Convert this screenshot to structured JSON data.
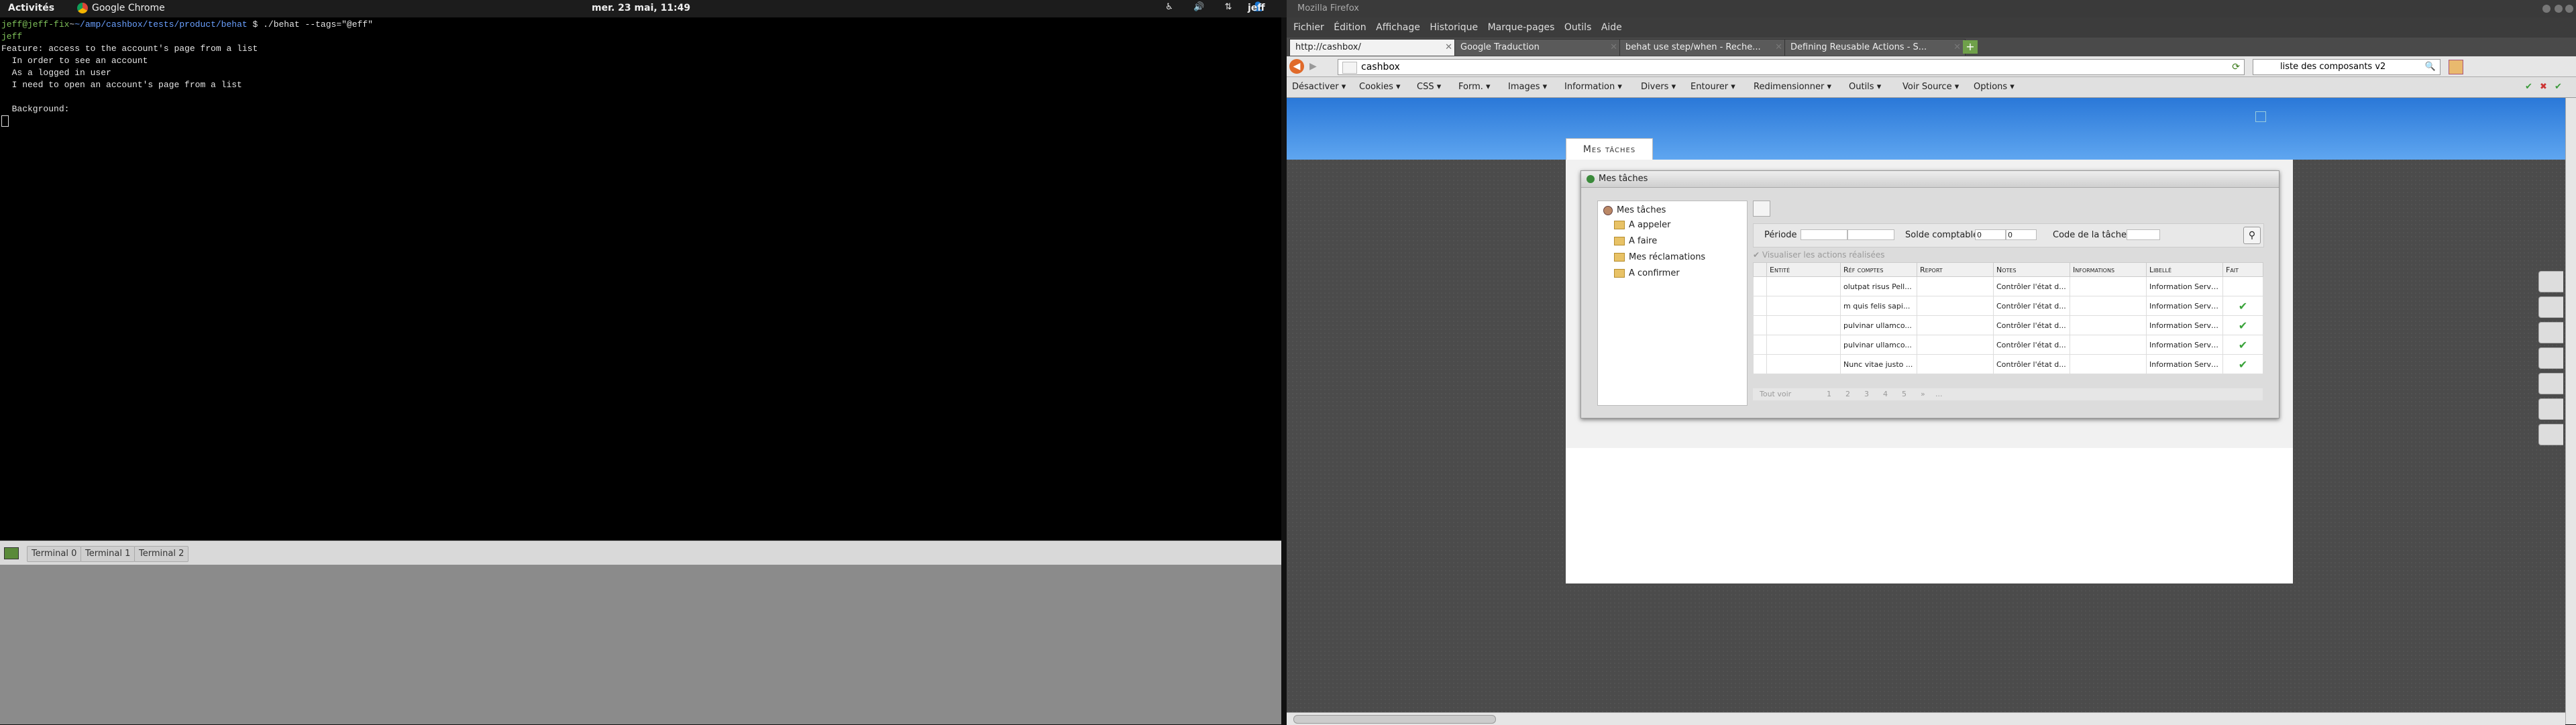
{
  "topbar": {
    "activities": "Activités",
    "app_name": "Google Chrome",
    "clock": "mer. 23 mai, 11:49",
    "user": "jeff"
  },
  "terminal": {
    "prompt_user": "jeff@jeff-fix",
    "prompt_path": "~/amp/cashbox/tests/product/behat",
    "command": "$ ./behat --tags=\"@eff\"",
    "prompt_line2": "jeff",
    "lines": [
      "Feature: access to the account's page from a list",
      "  In order to see an account",
      "  As a logged in user",
      "  I need to open an account's page from a list",
      "",
      "  Background:"
    ],
    "tabs": [
      "Terminal 0",
      "Terminal 1",
      "Terminal 2"
    ]
  },
  "firefox": {
    "window_title": "Mozilla Firefox",
    "menu": [
      "Fichier",
      "Édition",
      "Affichage",
      "Historique",
      "Marque-pages",
      "Outils",
      "Aide"
    ],
    "tabs": [
      {
        "label": "http://cashbox/",
        "active": true
      },
      {
        "label": "Google Traduction",
        "active": false
      },
      {
        "label": "behat use step/when - Reche...",
        "active": false
      },
      {
        "label": "Defining Reusable Actions - S...",
        "active": false
      }
    ],
    "url": "cashbox",
    "search_value": "liste des composants v2",
    "devbar": [
      "Désactiver ▾",
      "Cookies ▾",
      "CSS ▾",
      "Form. ▾",
      "Images ▾",
      "Information ▾",
      "Divers ▾",
      "Entourer ▾",
      "Redimensionner ▾",
      "Outils ▾",
      "Voir Source ▾",
      "Options ▾"
    ]
  },
  "app": {
    "title_tab": "Mes tâches",
    "dialog_title": "Mes tâches",
    "tree": {
      "root": "Mes tâches",
      "children": [
        "A appeler",
        "A faire",
        "Mes réclamations",
        "A confirmer"
      ]
    },
    "filters": {
      "periode_label": "Période",
      "solde_label": "Solde comptable",
      "solde_min": "0",
      "solde_max": "0",
      "code_label": "Code de la tâche"
    },
    "show_done_label": "Visualiser les actions réalisées",
    "columns": [
      "",
      "Entité",
      "Réf comptes",
      "Report",
      "Notes",
      "Informations",
      "Libellé",
      "Fait"
    ],
    "rows": [
      [
        "",
        "",
        "olutpat risus Pell...",
        "",
        "Contrôler l'état d...",
        "",
        "Information Servi...",
        ""
      ],
      [
        "",
        "",
        "m quis felis sapi...",
        "",
        "Contrôler l'état d...",
        "",
        "Information Servi...",
        "✔"
      ],
      [
        "",
        "",
        "pulvinar ullamco...",
        "",
        "Contrôler l'état d...",
        "",
        "Information Servi...",
        "✔"
      ],
      [
        "",
        "",
        "pulvinar ullamco...",
        "",
        "Contrôler l'état d...",
        "",
        "Information Servi...",
        "✔"
      ],
      [
        "",
        "",
        "Nunc vitae justo ...",
        "",
        "Contrôler l'état d...",
        "",
        "Information Servi...",
        "✔"
      ]
    ],
    "pager": {
      "select_all": "Tout voir",
      "pages": [
        "1",
        "2",
        "3",
        "4",
        "5",
        "»",
        "..."
      ]
    }
  }
}
